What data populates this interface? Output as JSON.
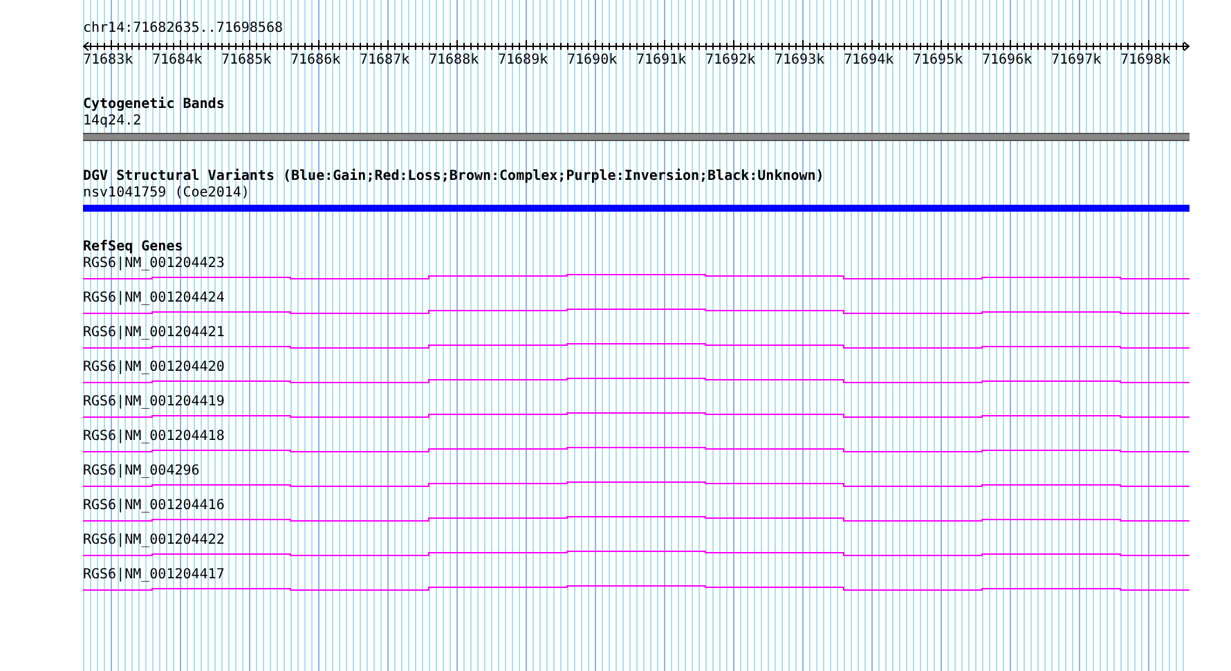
{
  "ruler": {
    "location": "chr14:71682635..71698568",
    "ticks": [
      "71683k",
      "71684k",
      "71685k",
      "71686k",
      "71687k",
      "71688k",
      "71689k",
      "71690k",
      "71691k",
      "71692k",
      "71693k",
      "71694k",
      "71695k",
      "71696k",
      "71697k",
      "71698k"
    ]
  },
  "tracks": [
    {
      "kind": "cytoband",
      "title": "Cytogenetic Bands",
      "features": [
        {
          "label": "14q24.2"
        }
      ]
    },
    {
      "kind": "variant",
      "title": "DGV Structural Variants (Blue:Gain;Red:Loss;Brown:Complex;Purple:Inversion;Black:Unknown)",
      "features": [
        {
          "label": "nsv1041759 (Coe2014)"
        }
      ]
    },
    {
      "kind": "gene",
      "title": "RefSeq Genes",
      "features": [
        {
          "label": "RGS6|NM_001204423"
        },
        {
          "label": "RGS6|NM_001204424"
        },
        {
          "label": "RGS6|NM_001204421"
        },
        {
          "label": "RGS6|NM_001204420"
        },
        {
          "label": "RGS6|NM_001204419"
        },
        {
          "label": "RGS6|NM_001204418"
        },
        {
          "label": "RGS6|NM_004296"
        },
        {
          "label": "RGS6|NM_001204416"
        },
        {
          "label": "RGS6|NM_001204422"
        },
        {
          "label": "RGS6|NM_001204417"
        }
      ]
    }
  ]
}
